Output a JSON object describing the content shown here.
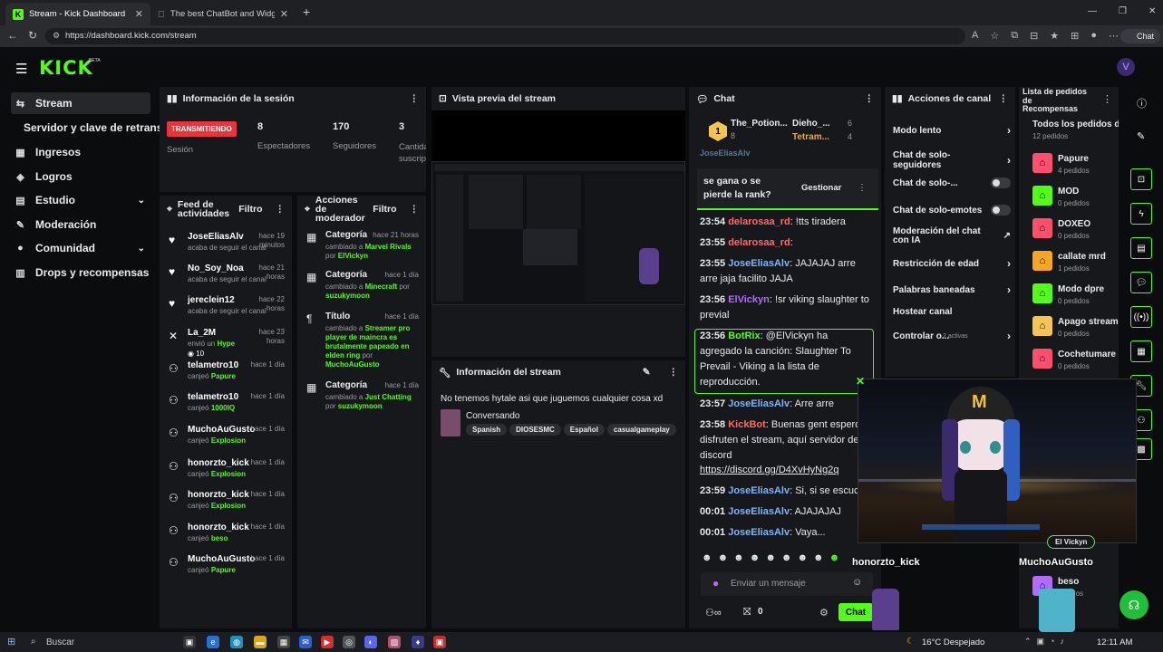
{
  "browser": {
    "tabs": [
      {
        "label": "Stream - Kick Dashboard",
        "active": true
      },
      {
        "label": "The best ChatBot and Widgets for",
        "active": false
      }
    ],
    "url": "https://dashboard.kick.com/stream",
    "chat_button": "Chat"
  },
  "brand": {
    "logo": "KICK",
    "beta": "BETA",
    "accent": "#53fc18"
  },
  "sidebar": {
    "items": [
      {
        "label": "Stream",
        "icon": "stream-icon",
        "selected": true
      },
      {
        "label": "Servidor y clave de retransmisi",
        "icon": "",
        "selected": false
      },
      {
        "label": "Ingresos",
        "icon": "income-icon",
        "selected": false
      },
      {
        "label": "Logros",
        "icon": "achievements-icon",
        "selected": false
      },
      {
        "label": "Estudio",
        "icon": "studio-icon",
        "selected": false
      },
      {
        "label": "Moderación",
        "icon": "moderation-icon",
        "selected": false
      },
      {
        "label": "Comunidad",
        "icon": "community-icon",
        "selected": false
      },
      {
        "label": "Drops y recompensas",
        "icon": "drops-icon",
        "selected": false
      }
    ]
  },
  "session": {
    "title": "Información de la sesión",
    "live_badge": "TRANSMITIENDO",
    "session_label": "Sesión",
    "stats": [
      {
        "value": "8",
        "label": "Espectadores"
      },
      {
        "value": "170",
        "label": "Seguidores"
      },
      {
        "value": "3",
        "label": "Cantidad suscrip"
      }
    ]
  },
  "preview": {
    "title": "Vista previa del stream"
  },
  "feed": {
    "title": "Feed de actividades",
    "filter": "Filtro",
    "items": [
      {
        "icon": "heart-icon",
        "name": "JoseEliasAlv",
        "when": "hace 19 minutos",
        "action": "acaba de seguir el canal",
        "highlight": ""
      },
      {
        "icon": "heart-icon",
        "name": "No_Soy_Noa",
        "when": "hace 21 horas",
        "action": "acaba de seguir el canal",
        "highlight": ""
      },
      {
        "icon": "heart-icon",
        "name": "jereclein12",
        "when": "hace 22 horas",
        "action": "acaba de seguir el canal",
        "highlight": ""
      },
      {
        "icon": "kick-icon",
        "name": "La_2M",
        "when": "hace 23 horas",
        "action": "envió un",
        "highlight": "Hype",
        "extra": "10"
      },
      {
        "icon": "redeem-icon",
        "name": "telametro10",
        "when": "hace 1 día",
        "action": "canjeó",
        "highlight": "Papure"
      },
      {
        "icon": "redeem-icon",
        "name": "telametro10",
        "when": "hace 1 día",
        "action": "canjeó",
        "highlight": "1000IQ"
      },
      {
        "icon": "redeem-icon",
        "name": "MuchoAuGusto",
        "when": "hace 1 día",
        "action": "canjeó",
        "highlight": "Explosion"
      },
      {
        "icon": "redeem-icon",
        "name": "honorzto_kick",
        "when": "hace 1 día",
        "action": "canjeó",
        "highlight": "Explosion"
      },
      {
        "icon": "redeem-icon",
        "name": "honorzto_kick",
        "when": "hace 1 día",
        "action": "canjeó",
        "highlight": "Explosion"
      },
      {
        "icon": "redeem-icon",
        "name": "honorzto_kick",
        "when": "hace 1 día",
        "action": "canjeó",
        "highlight": "beso"
      },
      {
        "icon": "redeem-icon",
        "name": "MuchoAuGusto",
        "when": "hace 1 día",
        "action": "canjeó",
        "highlight": "Papure"
      }
    ]
  },
  "modactions": {
    "title": "Acciones de moderador",
    "filter": "Filtro",
    "items": [
      {
        "title": "Categoría",
        "when": "hace 21 horas",
        "pre": "cambiado a",
        "value": "Marvel Rivals",
        "by": "por",
        "mod": "ElVickyn"
      },
      {
        "title": "Categoría",
        "when": "hace 1 día",
        "pre": "cambiado a",
        "value": "Minecraft",
        "by": "por",
        "mod": "suzukymoon"
      },
      {
        "title": "Título",
        "when": "hace 1 día",
        "pre": "cambiado a",
        "value": "Streamer pro player de maincra es brutalmente papeado en elden ring",
        "by": "por",
        "mod": "MuchoAuGusto"
      },
      {
        "title": "Categoría",
        "when": "hace 1 día",
        "pre": "cambiado a",
        "value": "Just Chatting",
        "by": "por",
        "mod": "suzukymoon"
      }
    ]
  },
  "streaminfo": {
    "title": "Información del stream",
    "stream_title": "No tenemos hytale asi que juguemos cualquier cosa xd",
    "category": "Conversando",
    "tags": [
      "Spanish",
      "DIOSESMC",
      "Español",
      "casualgameplay"
    ]
  },
  "chat": {
    "title": "Chat",
    "pinned": [
      {
        "name": "The_Potion...",
        "count": "8"
      },
      {
        "name": "Dieho_...",
        "count": "6"
      },
      {
        "name": "Tetram...",
        "count": "4"
      }
    ],
    "pinned_user": "JoseEliasAlv",
    "pinned_msg": "se gana o se pierde la rank?",
    "manage": "Gestionar",
    "messages": [
      {
        "time": "23:54",
        "user": "delarosaa_rd",
        "ucls": "u-red",
        "text": ": !tts tiradera"
      },
      {
        "time": "23:55",
        "user": "delarosaa_rd",
        "ucls": "u-red",
        "text": ":"
      },
      {
        "time": "23:55",
        "user": "JoseEliasAlv",
        "ucls": "u-blue",
        "text": ": JAJAJAJ arre arre jaja facilito JAJA"
      },
      {
        "time": "23:56",
        "user": "ElVickyn",
        "ucls": "u-purple",
        "text": ": !sr viking slaughter to previal"
      },
      {
        "time": "23:56",
        "user": "BotRix",
        "ucls": "u-green",
        "text": ": @ElVickyn ha agregado la canción: Slaughter To Prevail - Viking a la lista de reproducción."
      },
      {
        "time": "23:57",
        "user": "JoseEliasAlv",
        "ucls": "u-blue",
        "text": ": Arre arre"
      },
      {
        "time": "23:58",
        "user": "KickBot",
        "ucls": "u-red",
        "text": ": Buenas gent espero y disfruten el stream, aquí servidor de discord"
      },
      {
        "time": "",
        "user": "",
        "ucls": "",
        "text": "https://discord.gg/D4XvHyNg2q"
      },
      {
        "time": "23:59",
        "user": "JoseEliasAlv",
        "ucls": "u-blue",
        "text": ": Si, si se escuc"
      },
      {
        "time": "00:01",
        "user": "JoseEliasAlv",
        "ucls": "u-blue",
        "text": ": AJAJAJAJ"
      },
      {
        "time": "00:01",
        "user": "JoseEliasAlv",
        "ucls": "u-blue",
        "text": ": Vaya..."
      }
    ],
    "input_placeholder": "Enviar un mensaje",
    "counter": "0",
    "send": "Chat"
  },
  "channel": {
    "title": "Acciones de canal",
    "items": [
      {
        "label": "Modo lento",
        "ctrl": "chevron"
      },
      {
        "label": "Chat de solo-seguidores",
        "ctrl": "chevron"
      },
      {
        "label": "Chat de solo-...",
        "ctrl": "toggle"
      },
      {
        "label": "Chat de solo-emotes",
        "ctrl": "toggle"
      },
      {
        "label": "Moderación del chat con IA",
        "ctrl": "external"
      },
      {
        "label": "Restricción de edad",
        "ctrl": "chevron"
      },
      {
        "label": "Palabras baneadas",
        "ctrl": "chevron"
      },
      {
        "label": "Hostear canal",
        "ctrl": ""
      },
      {
        "label": "Controlar o...",
        "ctrl": "active",
        "extra": "2 activas"
      }
    ]
  },
  "rewards": {
    "title": "Lista de pedidos de Recompensas",
    "all_label": "Todos los pedidos de",
    "all_count": "12 pedidos",
    "items": [
      {
        "name": "Papure",
        "count": "4 pedidos",
        "color": "#ff4f6d"
      },
      {
        "name": "MOD",
        "count": "0 pedidos",
        "color": "#53fc18"
      },
      {
        "name": "DOXEO",
        "count": "0 pedidos",
        "color": "#ff4f6d"
      },
      {
        "name": "callate mrd",
        "count": "1 pedidos",
        "color": "#f6a623"
      },
      {
        "name": "Modo dpre",
        "count": "0 pedidos",
        "color": "#53fc18"
      },
      {
        "name": "Apago stream",
        "count": "0 pedidos",
        "color": "#f6c453"
      },
      {
        "name": "Cochetumare",
        "count": "0 pedidos",
        "color": "#ff4f6d"
      },
      {
        "name": "beso",
        "count": "pedidos",
        "color": "#b36bff"
      }
    ]
  },
  "overlay": {
    "streamer_tag": "El Vickyn",
    "name_left": "honorzto_kick",
    "name_right": "MuchoAuGusto"
  },
  "taskbar": {
    "search": "Buscar",
    "weather": "16°C Despejado",
    "time": "12:11 AM"
  }
}
